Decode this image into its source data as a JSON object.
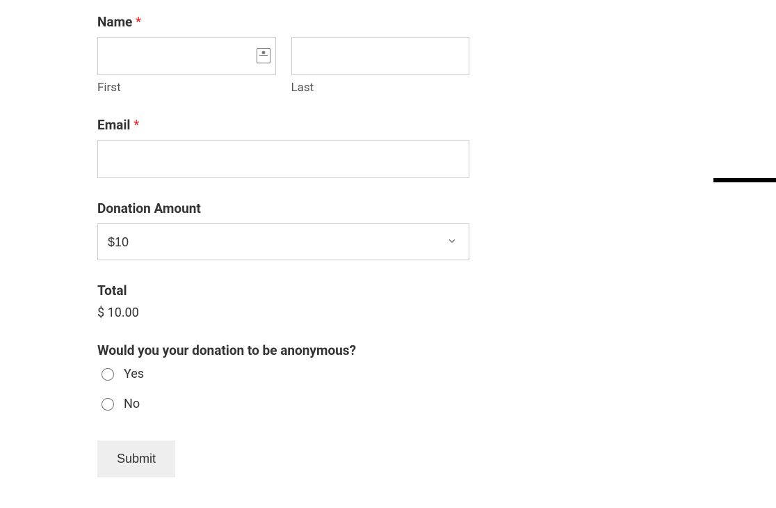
{
  "form": {
    "name": {
      "label": "Name",
      "required": true,
      "first_sublabel": "First",
      "last_sublabel": "Last",
      "first_value": "",
      "last_value": ""
    },
    "email": {
      "label": "Email",
      "required": true,
      "value": ""
    },
    "donation_amount": {
      "label": "Donation Amount",
      "selected": "$10"
    },
    "total": {
      "label": "Total",
      "value": "$ 10.00"
    },
    "anonymous": {
      "label": "Would you your donation to be anonymous?",
      "option_yes": "Yes",
      "option_no": "No"
    },
    "submit_label": "Submit"
  }
}
